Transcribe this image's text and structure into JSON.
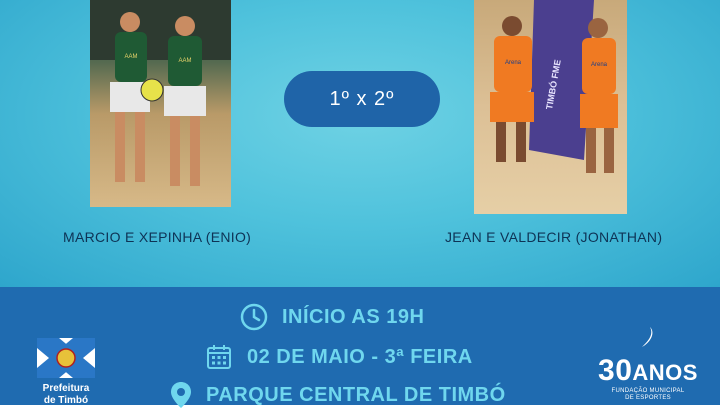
{
  "match": {
    "label": "1º x 2º"
  },
  "teams": {
    "left": "MARCIO E XEPINHA (ENIO)",
    "right": "JEAN E VALDECIR (JONATHAN)"
  },
  "info": {
    "time": "INÍCIO AS 19H",
    "date": "02 DE MAIO - 3ª FEIRA",
    "place": "PARQUE CENTRAL DE TIMBÓ"
  },
  "logos": {
    "prefeitura_line1": "Prefeitura",
    "prefeitura_line2": "de Timbó",
    "anos_number": "30",
    "anos_word": "ANOS",
    "fund_line1": "FUNDAÇÃO MUNICIPAL",
    "fund_line2": "DE ESPORTES"
  },
  "banner": {
    "text": "TIMBÓ FME"
  },
  "jerseys": {
    "left": "AAM",
    "right": "Arena"
  },
  "colors": {
    "accent_cyan": "#6fd7ee",
    "bottom_band": "#1f6bb0",
    "pill": "#1f64a8",
    "jersey_left": "#1f5a34",
    "jersey_right": "#f07a22"
  },
  "icons": [
    "clock-icon",
    "calendar-icon",
    "location-pin-icon"
  ]
}
